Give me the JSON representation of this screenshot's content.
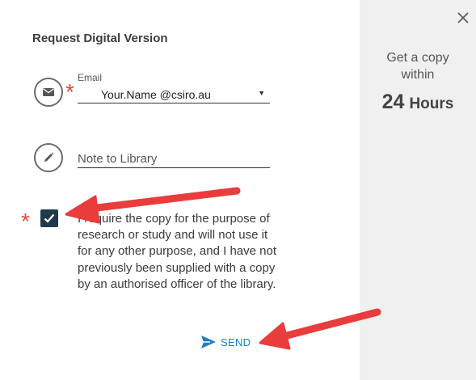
{
  "dialog": {
    "title": "Request Digital Version",
    "close_label": "X"
  },
  "form": {
    "email": {
      "label": "Email",
      "value": "Your.Name @csiro.au",
      "required_marker": "*"
    },
    "note": {
      "placeholder": "Note to Library"
    },
    "consent": {
      "checked": true,
      "required_marker": "*",
      "text": "I require the copy for the purpose of research or study and will not use it for any other purpose, and I have not previously been supplied with a copy by an authorised officer of the library."
    },
    "send_label": "SEND"
  },
  "promo": {
    "line1": "Get a copy",
    "line2": "within",
    "number": "24",
    "unit": "Hours"
  },
  "colors": {
    "accent": "#1c7ec5",
    "required": "#e8483c",
    "checkbox": "#1f3a4d",
    "annotation_arrow": "#ea3c3c",
    "side_panel": "#f0f0f0"
  },
  "icons": {
    "email": "envelope-icon",
    "note": "pencil-icon",
    "checkbox": "checkmark-icon",
    "send": "paper-plane-icon",
    "select": "caret-down-icon",
    "close": "close-icon"
  }
}
